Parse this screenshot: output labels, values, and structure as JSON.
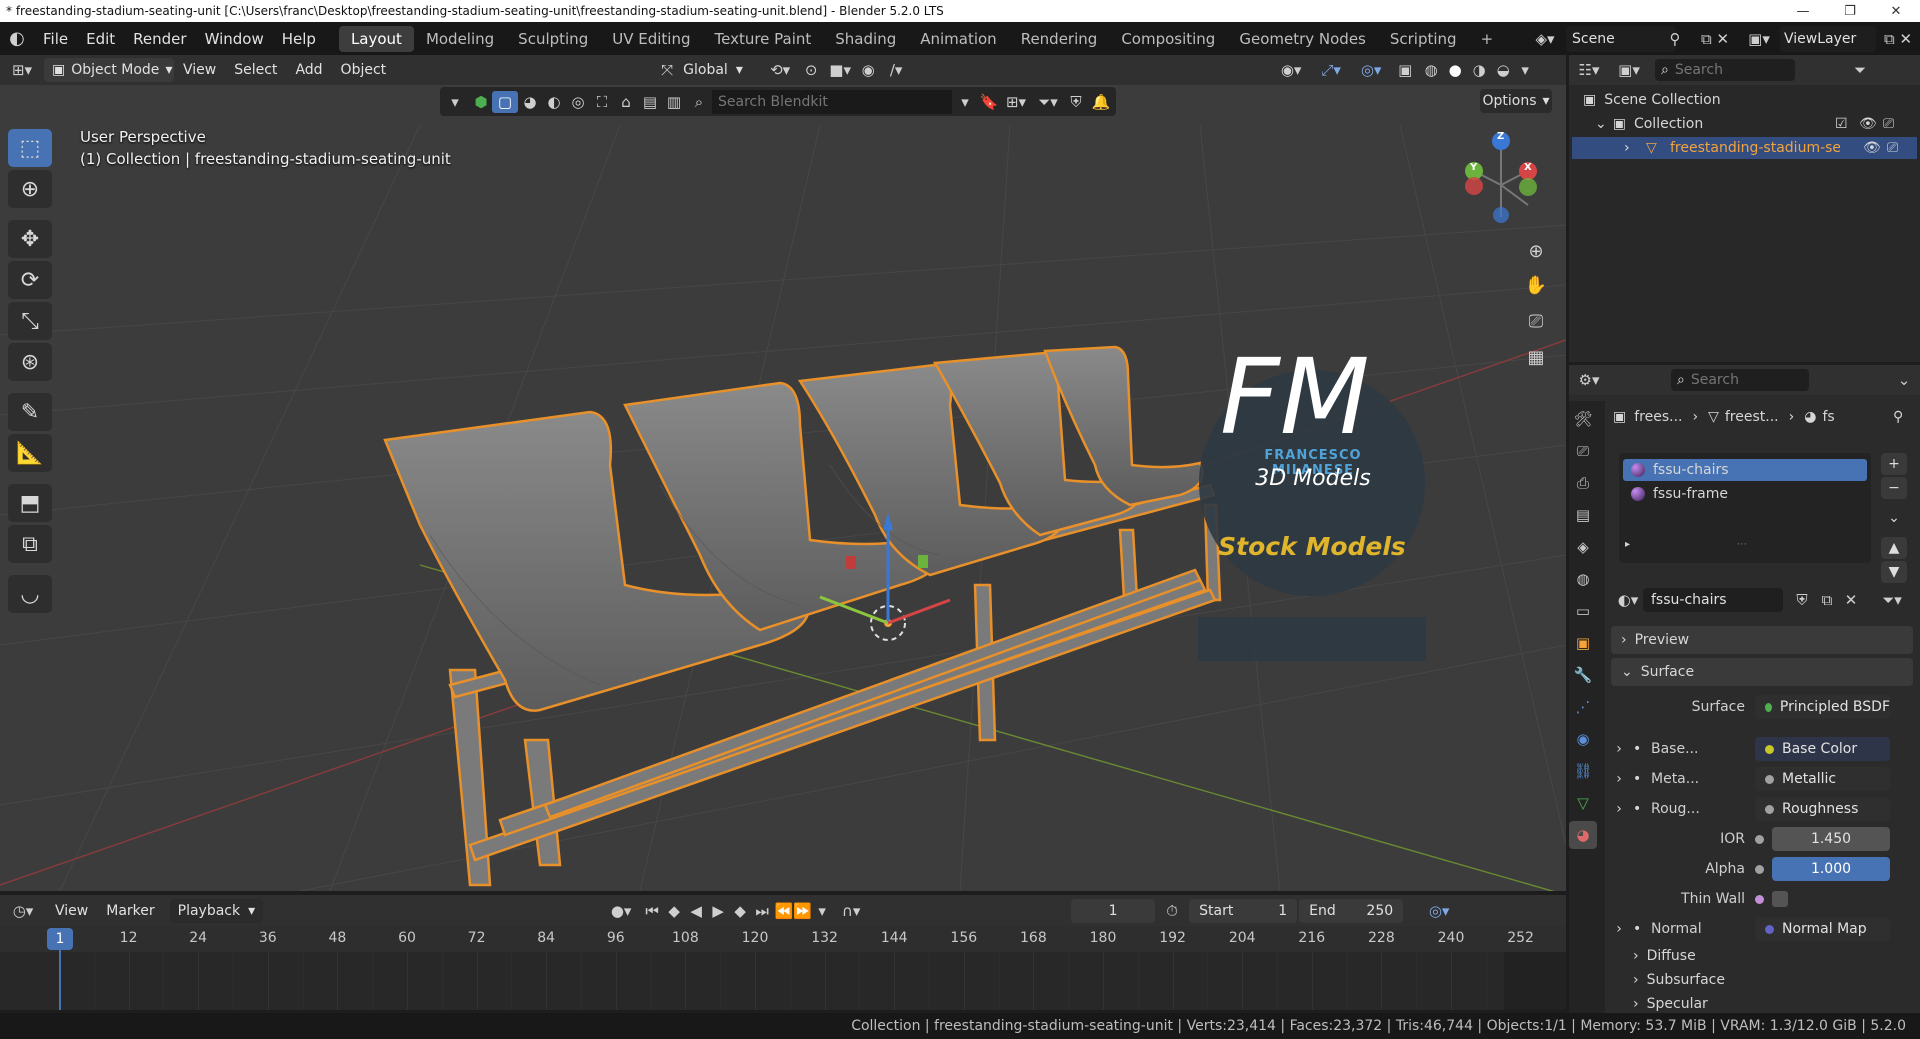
{
  "window": {
    "title": "* freestanding-stadium-seating-unit [C:\\Users\\franc\\Desktop\\freestanding-stadium-seating-unit\\freestanding-stadium-seating-unit.blend] - Blender 5.2.0 LTS",
    "minimize": "—",
    "maximize": "❐",
    "close": "✕"
  },
  "menubar": {
    "items": [
      "File",
      "Edit",
      "Render",
      "Window",
      "Help"
    ],
    "workspaces": [
      "Layout",
      "Modeling",
      "Sculpting",
      "UV Editing",
      "Texture Paint",
      "Shading",
      "Animation",
      "Rendering",
      "Compositing",
      "Geometry Nodes",
      "Scripting"
    ],
    "active_workspace": "Layout",
    "add_workspace": "+",
    "scene": "Scene",
    "view_layer": "ViewLayer"
  },
  "viewport_header": {
    "mode": "Object Mode",
    "menus": [
      "View",
      "Select",
      "Add",
      "Object"
    ],
    "orientation": "Global",
    "options": "Options"
  },
  "blendkit": {
    "search_placeholder": "Search Blendkit"
  },
  "viewport": {
    "perspective": "User Perspective",
    "collection_info": "(1) Collection | freestanding-stadium-seating-unit",
    "gizmo_axes": [
      "X",
      "Y",
      "Z"
    ],
    "watermark": {
      "logo": "FM",
      "name": "FRANCESCO MILANESE",
      "tag": "3D Models",
      "banner": "Stock Models"
    }
  },
  "timeline": {
    "menus": [
      "View",
      "Marker",
      "Playback"
    ],
    "current_frame": "1",
    "start_label": "Start",
    "start": "1",
    "end_label": "End",
    "end": "250",
    "ticks": [
      "1",
      "12",
      "24",
      "36",
      "48",
      "60",
      "72",
      "84",
      "96",
      "108",
      "120",
      "132",
      "144",
      "156",
      "168",
      "180",
      "192",
      "204",
      "216",
      "228",
      "240",
      "252"
    ]
  },
  "statusbar": {
    "text": "Collection | freestanding-stadium-seating-unit | Verts:23,414 | Faces:23,372 | Tris:46,744 | Objects:1/1 | Memory: 53.7 MiB | VRAM: 1.3/12.0 GiB | 5.2.0"
  },
  "outliner": {
    "search_placeholder": "Search",
    "scene_collection": "Scene Collection",
    "collection": "Collection",
    "object": "freestanding-stadium-sea"
  },
  "properties": {
    "search_placeholder": "Search",
    "breadcrumb": [
      "frees...",
      "freest...",
      "fs"
    ],
    "slots": [
      "fssu-chairs",
      "fssu-frame"
    ],
    "material_name": "fssu-chairs",
    "panels": {
      "preview": "Preview",
      "surface": "Surface"
    },
    "rows": [
      {
        "label": "Surface",
        "value": "Principled BSDF",
        "dot": "#4caf50"
      },
      {
        "label": "Base...",
        "value": "Base Color",
        "dot": "#c7c729"
      },
      {
        "label": "Meta...",
        "value": "Metallic",
        "dot": "#a1a1a1"
      },
      {
        "label": "Roug...",
        "value": "Roughness",
        "dot": "#a1a1a1"
      },
      {
        "label": "IOR",
        "value": "1.450",
        "dot": "#a1a1a1"
      },
      {
        "label": "Alpha",
        "value": "1.000",
        "dot": "#a1a1a1"
      },
      {
        "label": "Thin Wall",
        "value": "",
        "dot": "#c58fd6"
      },
      {
        "label": "Normal",
        "value": "Normal Map",
        "dot": "#6363c7"
      }
    ],
    "subpanels": [
      "Diffuse",
      "Subsurface",
      "Specular"
    ]
  }
}
